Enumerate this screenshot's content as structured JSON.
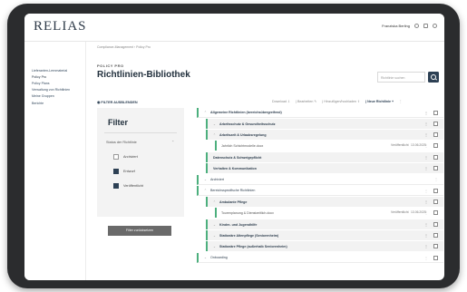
{
  "app": {
    "logo": "RELIAS"
  },
  "topbar": {
    "user": "Franziska Berling"
  },
  "sidebar": {
    "items": [
      {
        "label": "Lieferanten-Lernmaterial"
      },
      {
        "label": "Policy Pro"
      },
      {
        "label": "Policy Plans"
      },
      {
        "label": "Verwaltung von Richtlinien"
      },
      {
        "label": "Meine Gruppen"
      },
      {
        "label": "Berichte"
      }
    ]
  },
  "main": {
    "breadcrumb": "Compliance-Management › Policy Pro",
    "kicker": "POLICY PRO",
    "title": "Richtlinien-Bibliothek",
    "search_placeholder": "Richtlinie suchen",
    "filter_link": "FILTER AUSBLENDEN"
  },
  "toolbar": {
    "download": "Download",
    "edit": "Bearbeiten",
    "upload": "Hinzufügen/hochladen",
    "new": "Neue Richtlinie"
  },
  "filter": {
    "heading": "Filter",
    "status_label": "Status der Richtlinie",
    "options": [
      {
        "label": "Archiviert",
        "checked": false
      },
      {
        "label": "Entwurf",
        "checked": true
      },
      {
        "label": "Veröffentlicht",
        "checked": true
      }
    ],
    "reset_button": "Filter zurücksetzen"
  },
  "tree": {
    "r1": "Allgemeine Richtlinien (bereichsübergreifend)",
    "r2": "Arbeitsschutz & Gesundheitsschutz",
    "r3": "Arbeitszeit & Urlaubsregelung",
    "r4_doc": "Jahrlich Schichtmodelle.docx",
    "r4_status": "Veröffentlicht",
    "r4_date": "13.06.2025",
    "r5": "Datenschutz & Schweigepflicht",
    "r6": "Verhalten & Kommunikation",
    "r7": "Archiviert",
    "r8": "Bereichsspezifische Richtlinien",
    "r9": "Ambulante Pflege",
    "r10_doc": "Tourenplanung & Dienstzeitlich.docx",
    "r10_status": "Veröffentlicht",
    "r10_date": "13.06.2025",
    "r11": "Kinder- und Jugendhilfe",
    "r12": "Stationäre Altenpflege (Seniorenheim)",
    "r13": "Stationäre Pflege (außerhalb Seniorenheim)",
    "r14": "Onboarding"
  }
}
